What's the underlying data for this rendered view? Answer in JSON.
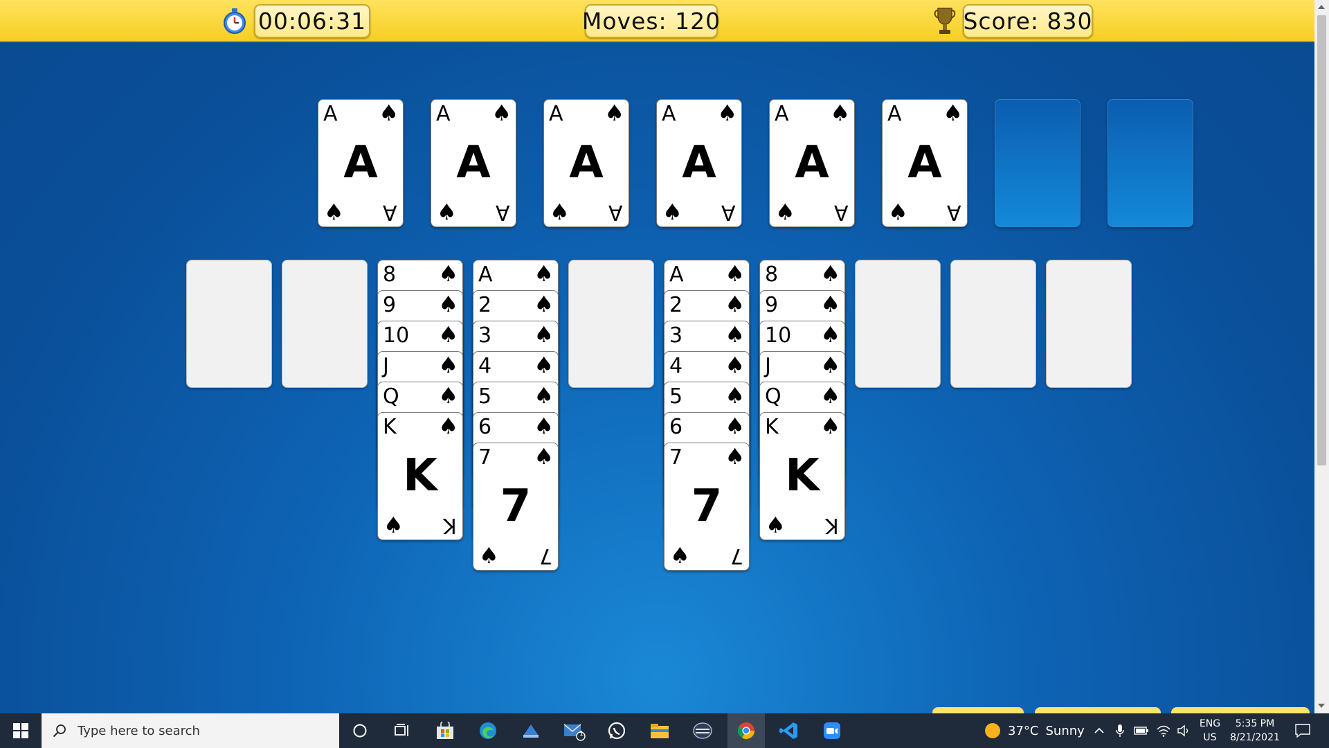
{
  "hud": {
    "timer": "00:06:31",
    "moves_label": "Moves: ",
    "moves": "120",
    "score_label": "Score: ",
    "score": "830",
    "timer_icon": "stopwatch-icon",
    "score_icon": "trophy-icon"
  },
  "foundations": [
    {
      "rank": "A",
      "suit": "♠"
    },
    {
      "rank": "A",
      "suit": "♠"
    },
    {
      "rank": "A",
      "suit": "♠"
    },
    {
      "rank": "A",
      "suit": "♠"
    },
    {
      "rank": "A",
      "suit": "♠"
    },
    {
      "rank": "A",
      "suit": "♠"
    },
    null,
    null
  ],
  "tableau": [
    [],
    [],
    [
      "8",
      "9",
      "10",
      "J",
      "Q",
      "K"
    ],
    [
      "A",
      "2",
      "3",
      "4",
      "5",
      "6",
      "7"
    ],
    [],
    [
      "A",
      "2",
      "3",
      "4",
      "5",
      "6",
      "7"
    ],
    [
      "8",
      "9",
      "10",
      "J",
      "Q",
      "K"
    ],
    [],
    [],
    []
  ],
  "suit": "♠",
  "taskbar": {
    "search_placeholder": "Type here to search",
    "weather_temp": "37°C",
    "weather_text": "Sunny",
    "lang_top": "ENG",
    "lang_bottom": "US",
    "time": "5:35 PM",
    "date": "8/21/2021",
    "mail_badge": "1",
    "icons": [
      "windows-start-icon",
      "search-icon",
      "cortana-icon",
      "task-view-icon",
      "store-icon",
      "edge-icon",
      "app-icon",
      "mail-icon",
      "whatsapp-icon",
      "file-explorer-icon",
      "app-icon",
      "chrome-icon",
      "vscode-icon",
      "zoom-icon"
    ]
  },
  "colors": {
    "topbar": "#f6cf23",
    "felt": "#0e63b4",
    "taskbar": "#1f2a3a"
  }
}
